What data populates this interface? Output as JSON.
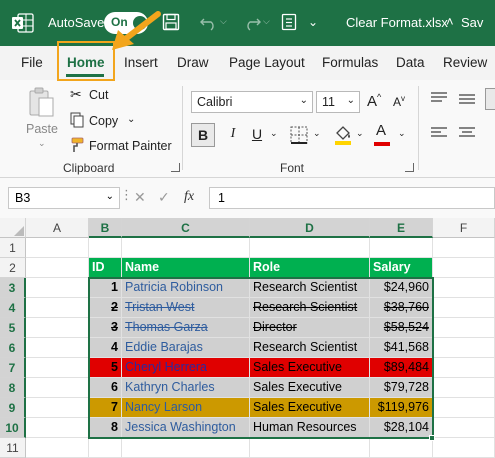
{
  "titlebar": {
    "autosave_label": "AutoSave",
    "toggle_text": "On",
    "filename": "Clear Format.xlsx",
    "saved_text": "Sav"
  },
  "tabs": [
    {
      "label": "File"
    },
    {
      "label": "Home",
      "active": true
    },
    {
      "label": "Insert"
    },
    {
      "label": "Draw"
    },
    {
      "label": "Page Layout"
    },
    {
      "label": "Formulas"
    },
    {
      "label": "Data"
    },
    {
      "label": "Review"
    }
  ],
  "ribbon": {
    "clipboard": {
      "paste_label": "Paste",
      "cut_label": "Cut",
      "copy_label": "Copy",
      "format_painter_label": "Format Painter",
      "group_label": "Clipboard"
    },
    "font": {
      "font_name": "Calibri",
      "font_size": "11",
      "group_label": "Font",
      "bold": "B",
      "italic": "I",
      "underline": "U",
      "grow": "A",
      "shrink": "A",
      "font_color": "A"
    }
  },
  "formula_bar": {
    "name_box": "B3",
    "fx": "fx",
    "value": "1"
  },
  "grid": {
    "columns": [
      "A",
      "B",
      "C",
      "D",
      "E",
      "F"
    ],
    "rows": [
      "1",
      "2",
      "3",
      "4",
      "5",
      "6",
      "7",
      "8",
      "9",
      "10",
      "11"
    ],
    "headers": [
      "ID",
      "Name",
      "Role",
      "Salary"
    ],
    "records": [
      {
        "id": "1",
        "name": "Patricia Robinson",
        "role": "Research Scientist",
        "salary": "$24,960",
        "strike": false,
        "fill": "#d0d0d0"
      },
      {
        "id": "2",
        "name": "Tristan West",
        "role": "Research Scientist",
        "salary": "$38,760",
        "strike": true,
        "fill": "#d0d0d0"
      },
      {
        "id": "3",
        "name": "Thomas Garza",
        "role": "Director",
        "salary": "$58,524",
        "strike": true,
        "fill": "#d0d0d0"
      },
      {
        "id": "4",
        "name": "Eddie Barajas",
        "role": "Research Scientist",
        "salary": "$41,568",
        "strike": false,
        "fill": "#d0d0d0"
      },
      {
        "id": "5",
        "name": "Cheryl Herrera",
        "role": "Sales Executive",
        "salary": "$89,484",
        "strike": false,
        "fill": "#e00000"
      },
      {
        "id": "6",
        "name": "Kathryn Charles",
        "role": "Sales Executive",
        "salary": "$79,728",
        "strike": false,
        "fill": "#d0d0d0"
      },
      {
        "id": "7",
        "name": "Nancy Larson",
        "role": "Sales Executive",
        "salary": "$119,976",
        "strike": false,
        "fill": "#cc9900"
      },
      {
        "id": "8",
        "name": "Jessica Washington",
        "role": "Human Resources",
        "salary": "$28,104",
        "strike": false,
        "fill": "#d0d0d0"
      }
    ]
  },
  "colors": {
    "brand": "#1e7145",
    "header_fill": "#00b050",
    "name_text": "#2e5c9e",
    "highlight": "#f2a51c"
  }
}
